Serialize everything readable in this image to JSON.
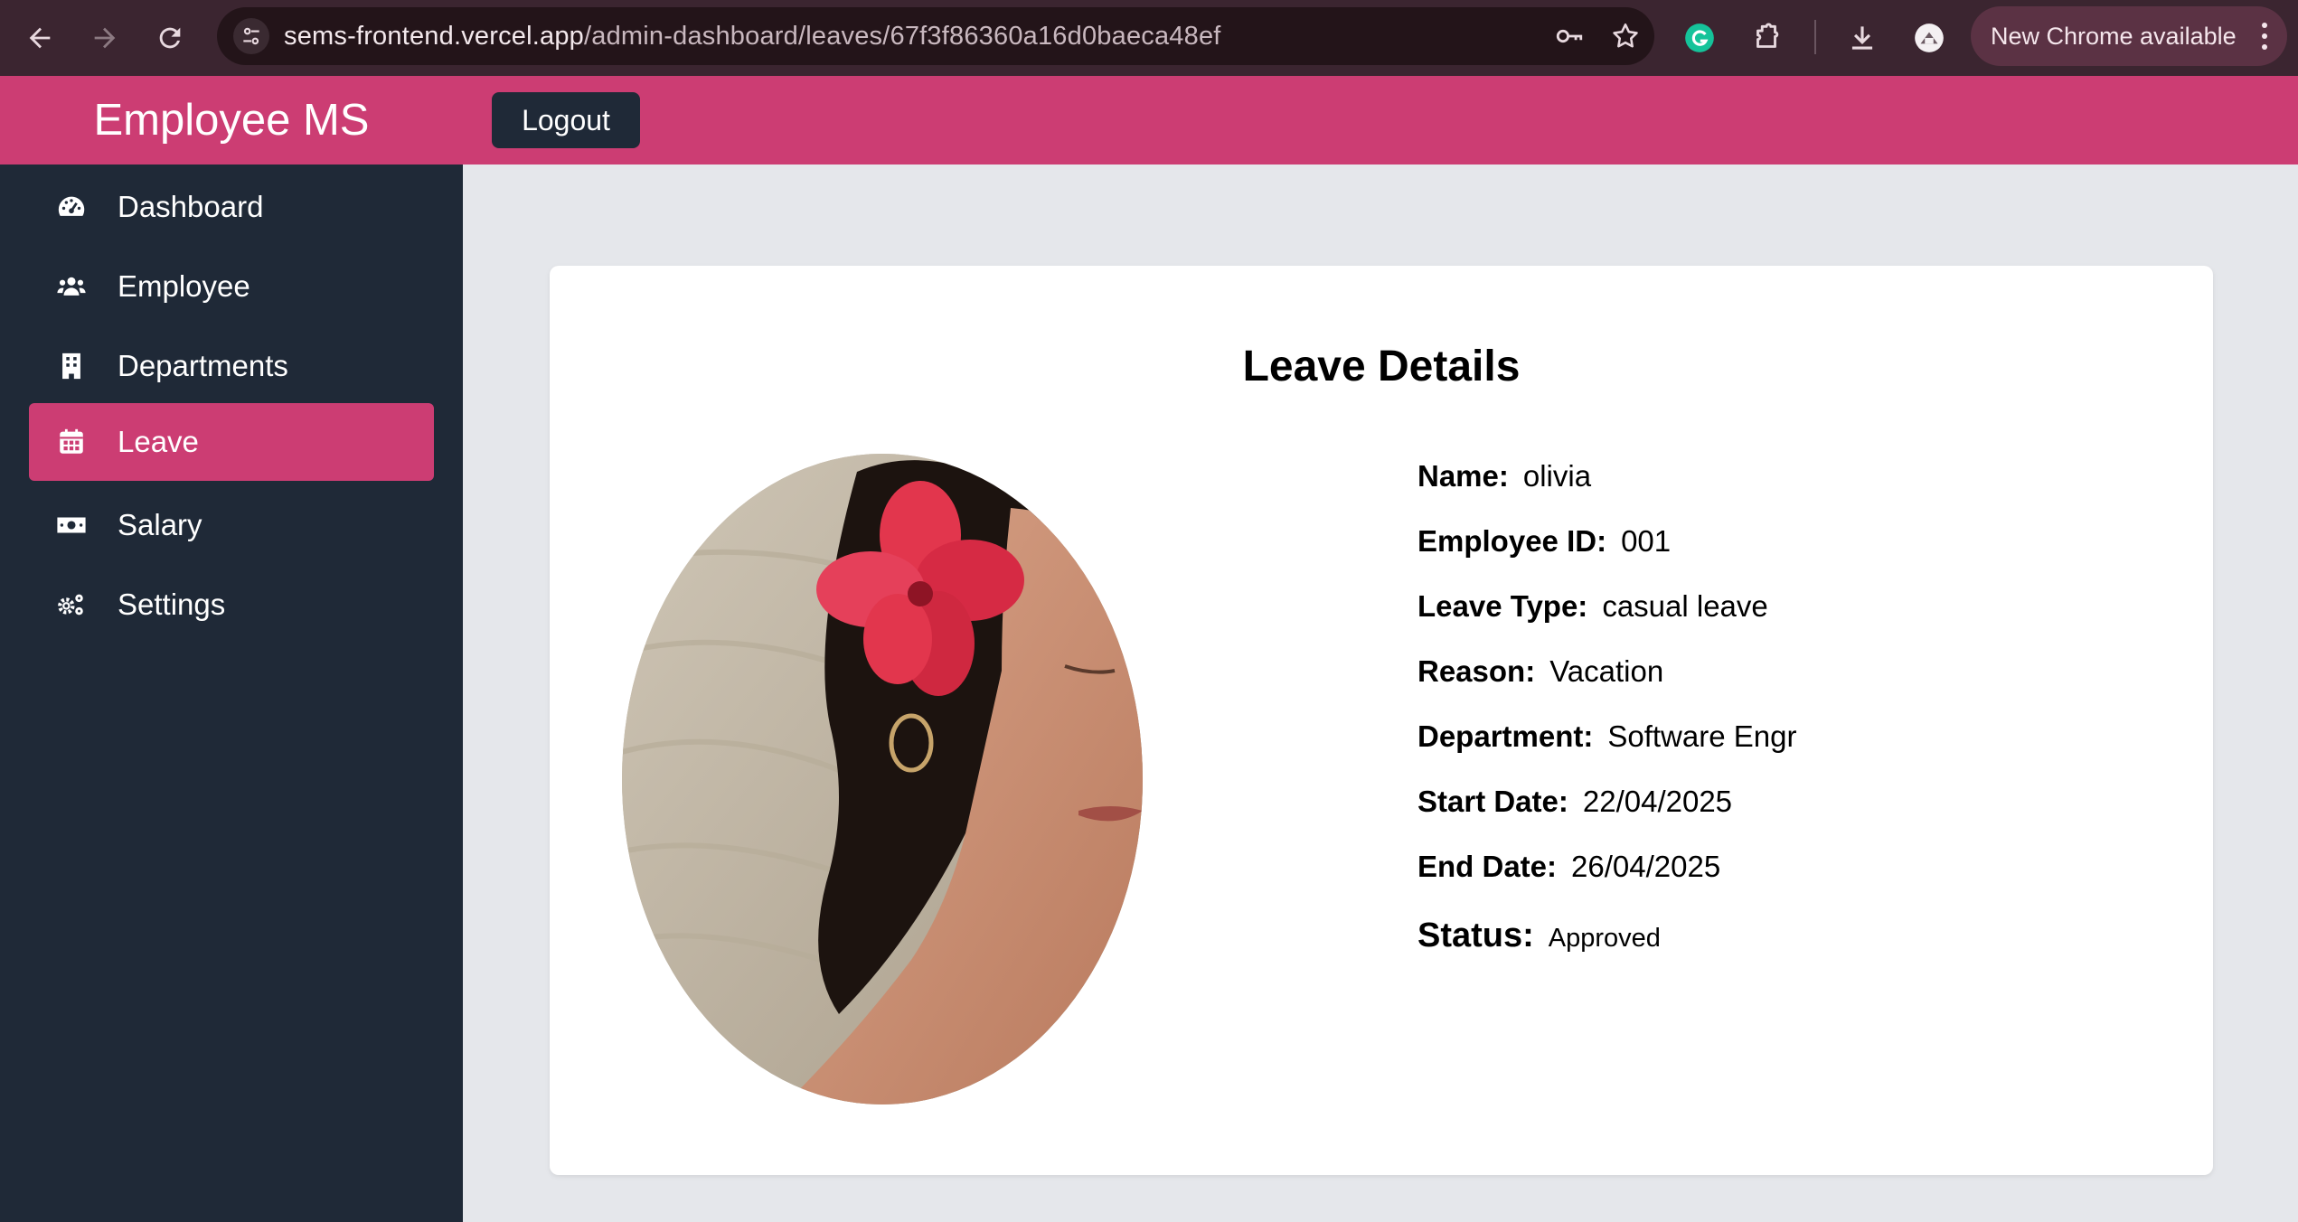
{
  "browser": {
    "url_host": "sems-frontend.vercel.app",
    "url_path": "/admin-dashboard/leaves/67f3f86360a16d0baeca48ef",
    "new_chrome_label": "New Chrome available",
    "icons": {
      "back": "arrow-left-icon",
      "forward": "arrow-right-icon",
      "reload": "reload-icon",
      "site_settings": "tune-icon",
      "password": "key-icon",
      "bookmark": "star-icon",
      "extension_g": "grammarly-icon",
      "extensions": "puzzle-icon",
      "download": "download-icon",
      "profile": "profile-avatar-icon",
      "menu": "more-vert-icon"
    }
  },
  "header": {
    "brand": "Employee MS",
    "logout_label": "Logout",
    "color": "#cc3d73"
  },
  "sidebar": {
    "color": "#1f2937",
    "items": [
      {
        "label": "Dashboard",
        "icon": "gauge-icon",
        "active": false
      },
      {
        "label": "Employee",
        "icon": "users-icon",
        "active": false
      },
      {
        "label": "Departments",
        "icon": "building-icon",
        "active": false
      },
      {
        "label": "Leave",
        "icon": "calendar-icon",
        "active": true
      },
      {
        "label": "Salary",
        "icon": "money-bill-icon",
        "active": false
      },
      {
        "label": "Settings",
        "icon": "gears-icon",
        "active": false
      }
    ]
  },
  "leave_details": {
    "title": "Leave Details",
    "fields": [
      {
        "label": "Name:",
        "value": "olivia"
      },
      {
        "label": "Employee ID:",
        "value": "001"
      },
      {
        "label": "Leave Type:",
        "value": "casual leave"
      },
      {
        "label": "Reason:",
        "value": "Vacation"
      },
      {
        "label": "Department:",
        "value": "Software Engr"
      },
      {
        "label": "Start Date:",
        "value": "22/04/2025"
      },
      {
        "label": "End Date:",
        "value": "26/04/2025"
      },
      {
        "label": "Status:",
        "value": "Approved"
      }
    ]
  }
}
